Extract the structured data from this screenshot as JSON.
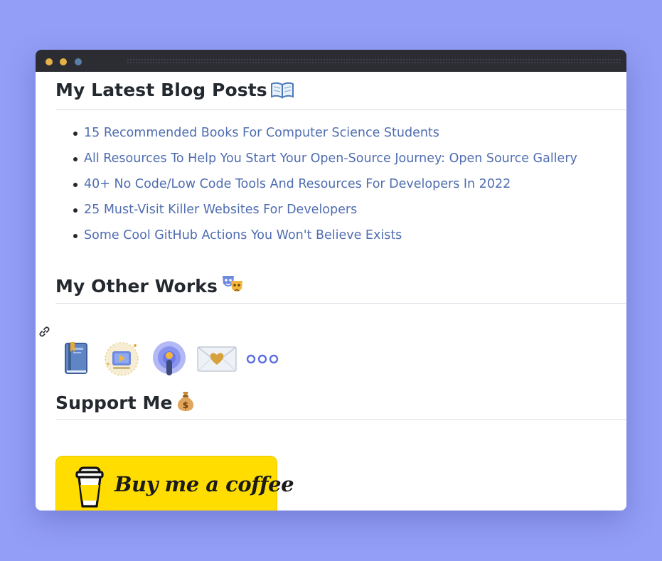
{
  "window": {
    "traffic_lights": [
      "#e5b247",
      "#e5b247",
      "#5a7fa6"
    ]
  },
  "sections": {
    "blog": {
      "heading": "My Latest Blog Posts",
      "icon": "open-book-icon",
      "posts": [
        "15 Recommended Books For Computer Science Students",
        "All Resources To Help You Start Your Open-Source Journey: Open Source Gallery",
        "40+ No Code/Low Code Tools And Resources For Developers In 2022",
        "25 Must-Visit Killer Websites For Developers",
        "Some Cool GitHub Actions You Won't Believe Exists"
      ]
    },
    "works": {
      "heading": "My Other Works",
      "icon": "performing-arts-icon",
      "items": [
        "book-icon",
        "video-icon",
        "podcast-icon",
        "heart-letter-icon",
        "more-icon"
      ]
    },
    "support": {
      "heading": "Support Me",
      "icon": "money-bag-icon",
      "button_label": "Buy me a coffee",
      "button_color": "#ffdd00"
    }
  },
  "colors": {
    "background": "#939ef6",
    "link": "#4f6db0",
    "heading": "#24292f"
  }
}
